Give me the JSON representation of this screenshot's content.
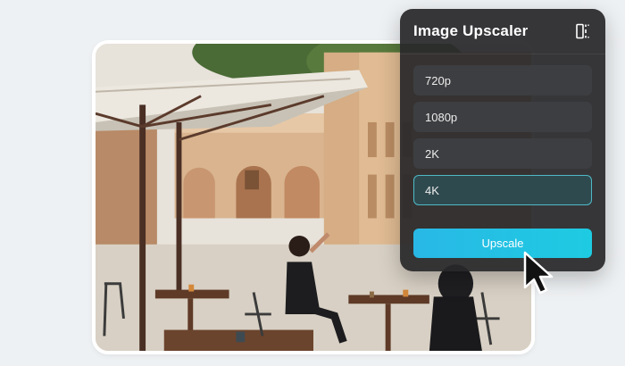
{
  "panel": {
    "title": "Image Upscaler",
    "compare_icon": "split-view-icon",
    "options": [
      {
        "label": "720p",
        "selected": false
      },
      {
        "label": "1080p",
        "selected": false
      },
      {
        "label": "2K",
        "selected": false
      },
      {
        "label": "4K",
        "selected": true
      }
    ],
    "action_label": "Upscale"
  },
  "photo": {
    "subject": "cafe-courtyard-photo"
  },
  "colors": {
    "panel_bg": "#28282a",
    "option_bg": "#3d3e41",
    "selected_border": "#4fb9c6",
    "accent": "#1ecbe2",
    "page_bg": "#eef1f3"
  }
}
